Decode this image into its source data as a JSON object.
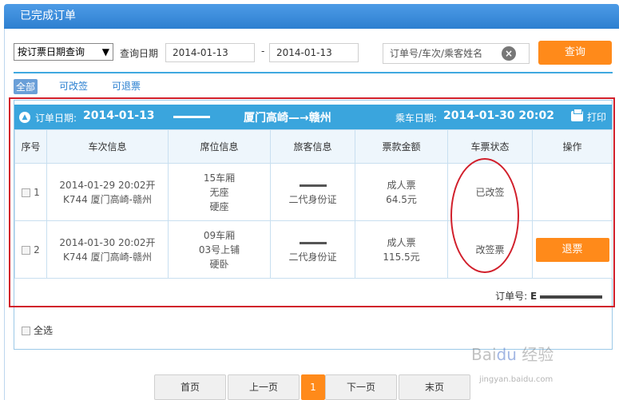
{
  "page": {
    "title": "已完成订单"
  },
  "search": {
    "type_selected": "按订票日期查询",
    "date_label": "查询日期",
    "date_from": "2014-01-13",
    "dash": "-",
    "date_to": "2014-01-13",
    "order_placeholder": "订单号/车次/乘客姓名",
    "query_label": "查询"
  },
  "filters": {
    "all": "全部",
    "changeable": "可改签",
    "refundable": "可退票"
  },
  "order": {
    "order_date_label": "订单日期:",
    "order_date": "2014-01-13",
    "route": "厦门高崎—→赣州",
    "ride_date_label": "乘车日期:",
    "ride_date": "2014-01-30 20:02",
    "print_label": "打印",
    "order_no_label": "订单号:",
    "order_no_prefix": "E"
  },
  "table": {
    "headers": [
      "序号",
      "车次信息",
      "席位信息",
      "旅客信息",
      "票款金额",
      "车票状态",
      "操作"
    ],
    "rows": [
      {
        "index": "1",
        "train_line1": "2014-01-29 20:02开",
        "train_line2": "K744 厦门高崎-赣州",
        "seat_line1": "15车厢",
        "seat_line2": "无座",
        "seat_line3": "硬座",
        "passenger_id": "二代身份证",
        "fare_type": "成人票",
        "fare_amount": "64.5元",
        "status": "已改签",
        "action": ""
      },
      {
        "index": "2",
        "train_line1": "2014-01-30 20:02开",
        "train_line2": "K744 厦门高崎-赣州",
        "seat_line1": "09车厢",
        "seat_line2": "03号上铺",
        "seat_line3": "硬卧",
        "passenger_id": "二代身份证",
        "fare_type": "成人票",
        "fare_amount": "115.5元",
        "status": "改签票",
        "action": "退票"
      }
    ]
  },
  "select_all": "全选",
  "pager": {
    "first": "首页",
    "prev": "上一页",
    "current": "1",
    "next": "下一页",
    "last": "末页"
  },
  "watermark": {
    "site": "jingyan.baidu.com"
  },
  "colors": {
    "header_blue": "#3aa5dd",
    "accent_orange": "#ff8a1a",
    "annotation_red": "#d11f2b"
  }
}
